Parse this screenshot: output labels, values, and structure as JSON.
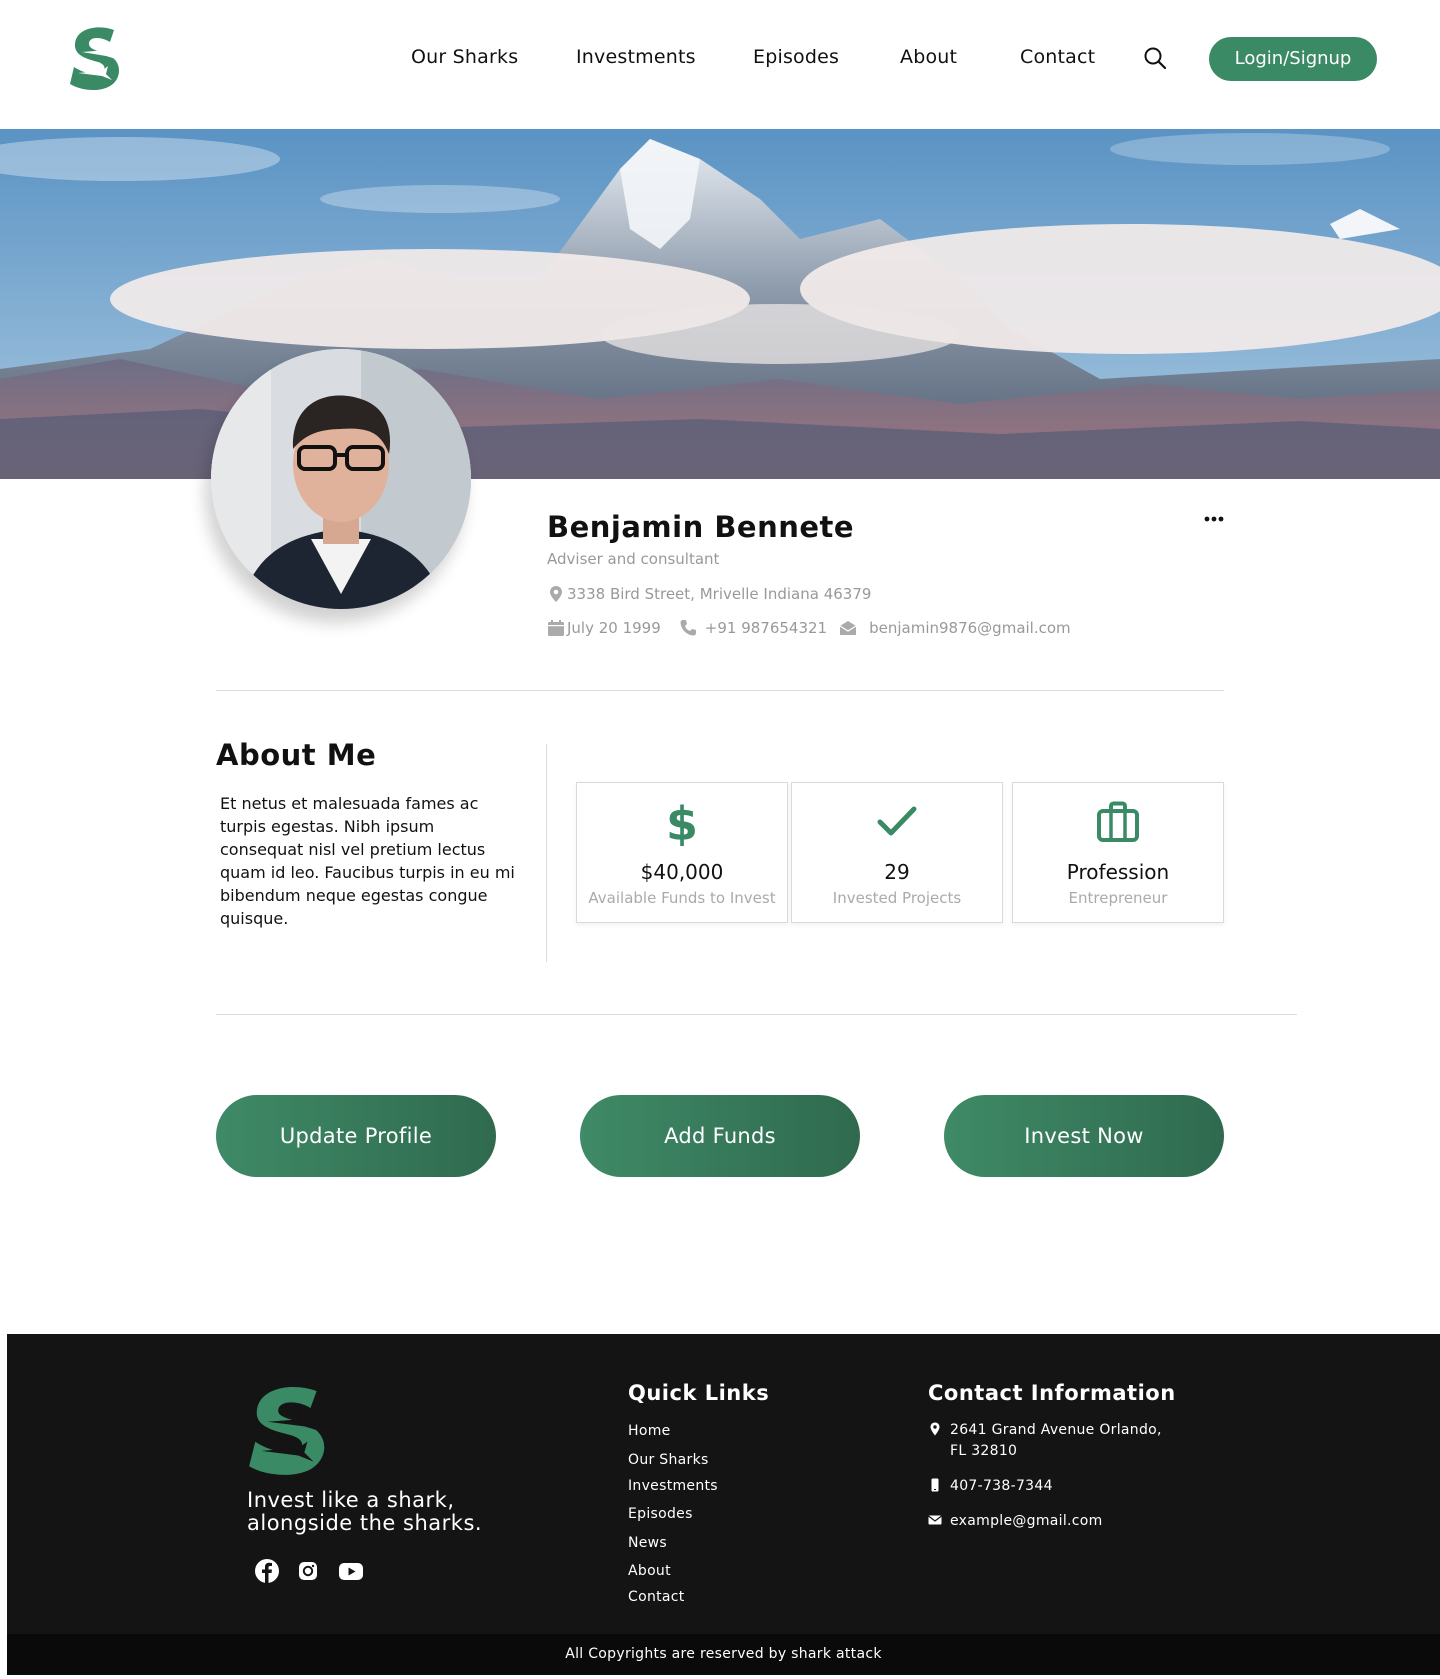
{
  "nav": {
    "logo": "shark-s-logo",
    "links": [
      "Our Sharks",
      "Investments",
      "Episodes",
      "About",
      "Contact"
    ],
    "search_icon": "search-icon",
    "login_label": "Login/Signup"
  },
  "profile": {
    "name": "Benjamin Bennete",
    "role": "Adviser and consultant",
    "address": "3338 Bird Street, Mrivelle Indiana 46379",
    "dob": "July 20 1999",
    "phone": "+91 987654321",
    "email": "benjamin9876@gmail.com"
  },
  "about": {
    "title": "About Me",
    "text": "Et netus et malesuada fames ac turpis egestas. Nibh ipsum consequat nisl vel pretium lectus quam id leo. Faucibus turpis in eu mi bibendum neque egestas congue quisque."
  },
  "stats": [
    {
      "icon": "dollar-icon",
      "value": "$40,000",
      "label": "Available Funds to Invest"
    },
    {
      "icon": "check-icon",
      "value": "29",
      "label": "Invested Projects"
    },
    {
      "icon": "briefcase-icon",
      "value": "Profession",
      "label": "Entrepreneur"
    }
  ],
  "actions": {
    "update": "Update Profile",
    "add_funds": "Add Funds",
    "invest": "Invest Now"
  },
  "footer": {
    "tagline": "Invest like a shark, alongside the sharks.",
    "social": [
      "facebook-icon",
      "instagram-icon",
      "youtube-icon"
    ],
    "quick_links_title": "Quick Links",
    "quick_links": [
      "Home",
      "Our Sharks",
      "Investments",
      "Episodes",
      "News",
      "About",
      "Contact"
    ],
    "contact_title": "Contact Information",
    "contact_address_1": "2641 Grand Avenue Orlando,",
    "contact_address_2": "FL 32810",
    "contact_phone": "407-738-7344",
    "contact_email": "example@gmail.com",
    "copyright": "All Copyrights are reserved by shark attack"
  },
  "colors": {
    "accent": "#3a8a66",
    "button_gradient_start": "#3f8a67",
    "button_gradient_end": "#2f6a4f",
    "footer_bg": "#141414"
  }
}
